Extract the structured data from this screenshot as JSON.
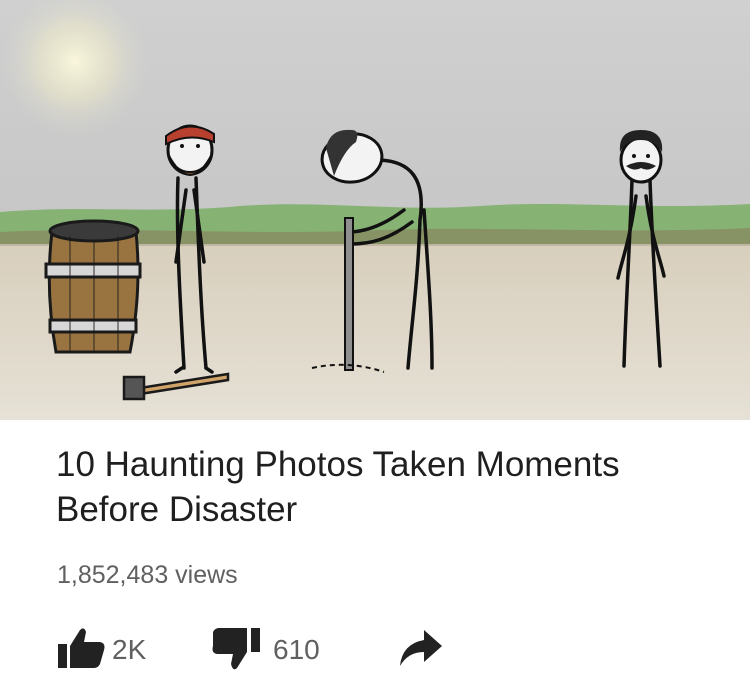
{
  "video": {
    "title": "10 Haunting Photos Taken Moments Before Disaster",
    "views": "1,852,483 views"
  },
  "actions": {
    "likes": "2K",
    "dislikes": "610"
  },
  "icons": {
    "like": "thumbs-up-icon",
    "dislike": "thumbs-down-icon",
    "share": "share-arrow-icon"
  },
  "colors": {
    "sky": "#c9c9c9",
    "grass": "#7fae6e",
    "ground": "#dcd6c6",
    "text_primary": "#1f1f1f",
    "text_secondary": "#606060"
  }
}
